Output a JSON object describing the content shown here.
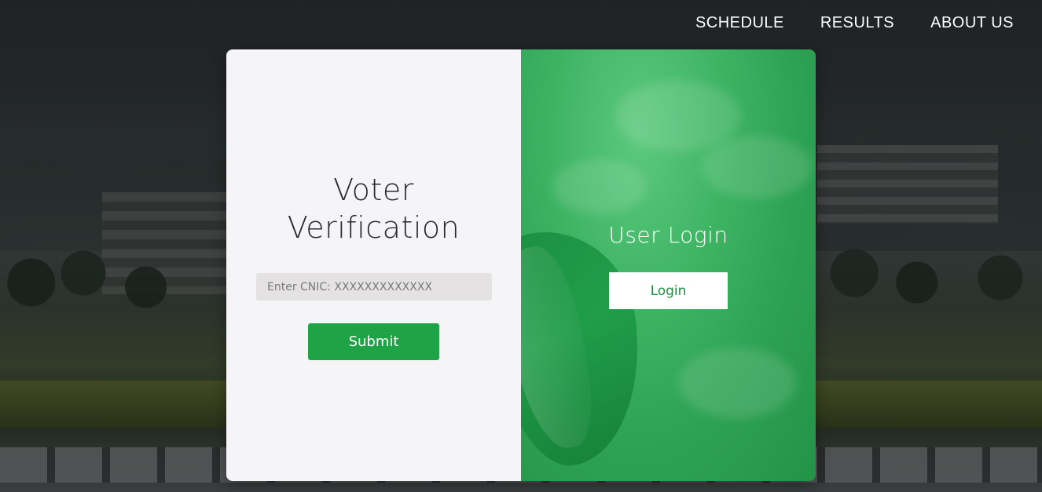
{
  "nav": {
    "items": [
      {
        "label": "SCHEDULE"
      },
      {
        "label": "RESULTS"
      },
      {
        "label": "ABOUT US"
      }
    ]
  },
  "verification": {
    "title_line1": "Voter",
    "title_line2": "Verification",
    "cnic_placeholder": "Enter CNIC: XXXXXXXXXXXXX",
    "cnic_value": "",
    "submit_label": "Submit"
  },
  "login_panel": {
    "title": "User Login",
    "login_label": "Login"
  },
  "colors": {
    "accent_green": "#1fa347",
    "panel_green": "#3eb463",
    "light_panel": "#f5f5f7",
    "input_bg": "#e4e2e3"
  }
}
